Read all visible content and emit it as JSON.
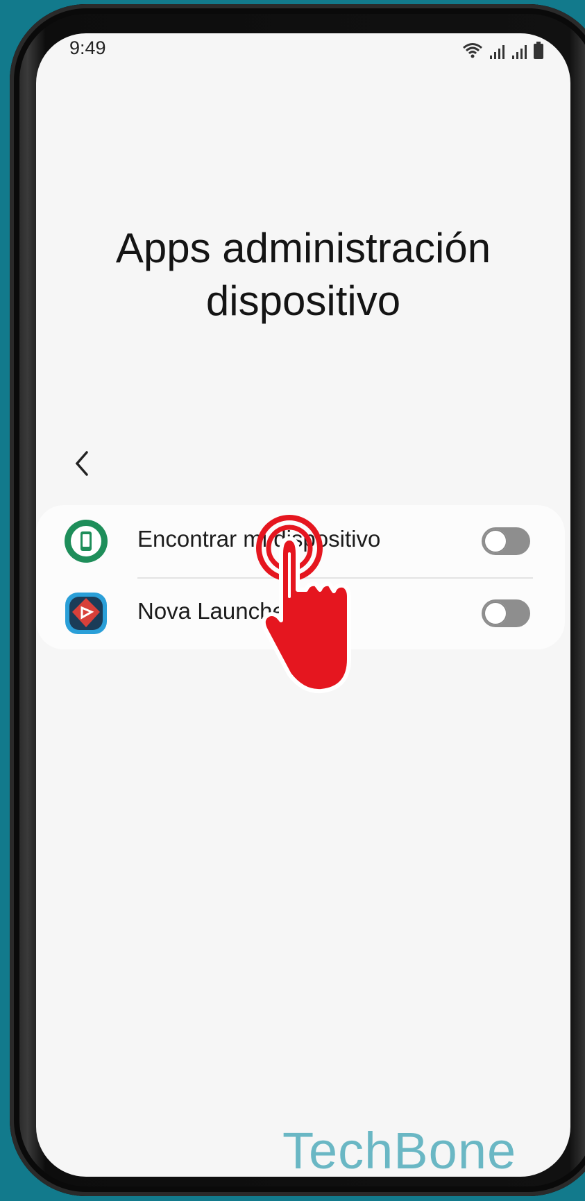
{
  "status_bar": {
    "time": "9:49",
    "icons": [
      "wifi-icon",
      "signal-icon",
      "signal-icon",
      "battery-icon"
    ]
  },
  "page": {
    "title_line1": "Apps administración",
    "title_line2": "dispositivo"
  },
  "apps": [
    {
      "label": "Encontrar mi dispositivo",
      "icon": "find-my-device-icon",
      "enabled": false
    },
    {
      "label": "Nova Launcher",
      "icon": "nova-launcher-icon",
      "enabled": false
    }
  ],
  "watermark": "TechBone",
  "colors": {
    "screen_bg": "#f6f6f6",
    "toggle_off": "#8e8e8e",
    "find_icon_green": "#1e8e5a",
    "nova_red": "#d8403a",
    "nova_blue": "#2a9fd8",
    "hand_red": "#e5161f",
    "watermark": "#6ab7c4",
    "background": "#127a8c"
  }
}
